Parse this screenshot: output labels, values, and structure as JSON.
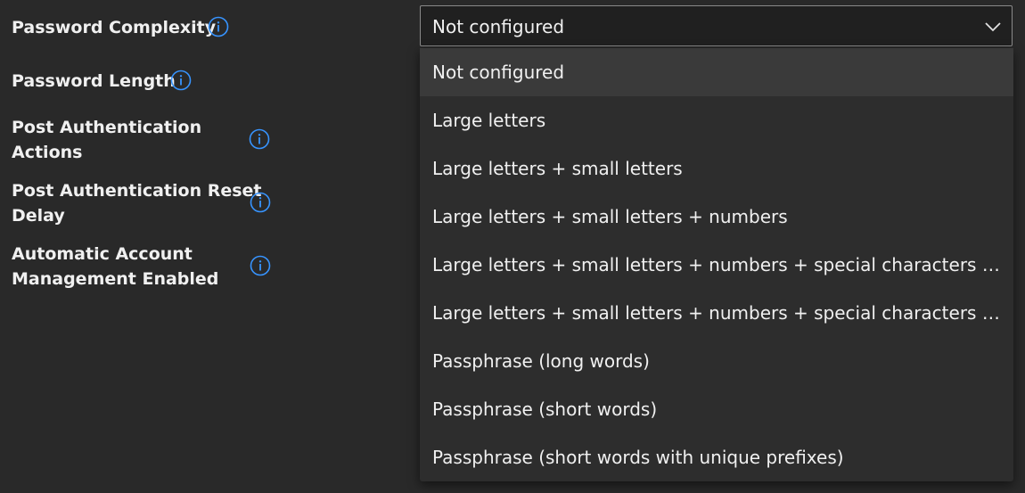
{
  "settings": [
    {
      "label": "Password Complexity"
    },
    {
      "label": "Password Length"
    },
    {
      "label_line1": "Post Authentication",
      "label_line2": "Actions"
    },
    {
      "label_line1": "Post Authentication Reset",
      "label_line2": "Delay"
    },
    {
      "label_line1": "Automatic Account",
      "label_line2": "Management Enabled"
    }
  ],
  "icons": {
    "info": "info-circle-icon",
    "chevron": "chevron-down-icon"
  },
  "colors": {
    "background": "#292929",
    "dropdown_background": "#2d2d2d",
    "selected_option": "#3a3a3a",
    "info_icon": "#3794ff"
  },
  "select": {
    "value": "Not configured",
    "options": [
      "Not configured",
      "Large letters",
      "Large letters + small letters",
      "Large letters + small letters + numbers",
      "Large letters + small letters + numbers + special characters (Default)",
      "Large letters + small letters + numbers + special characters (impro...",
      "Passphrase (long words)",
      "Passphrase (short words)",
      "Passphrase (short words with unique prefixes)"
    ]
  }
}
